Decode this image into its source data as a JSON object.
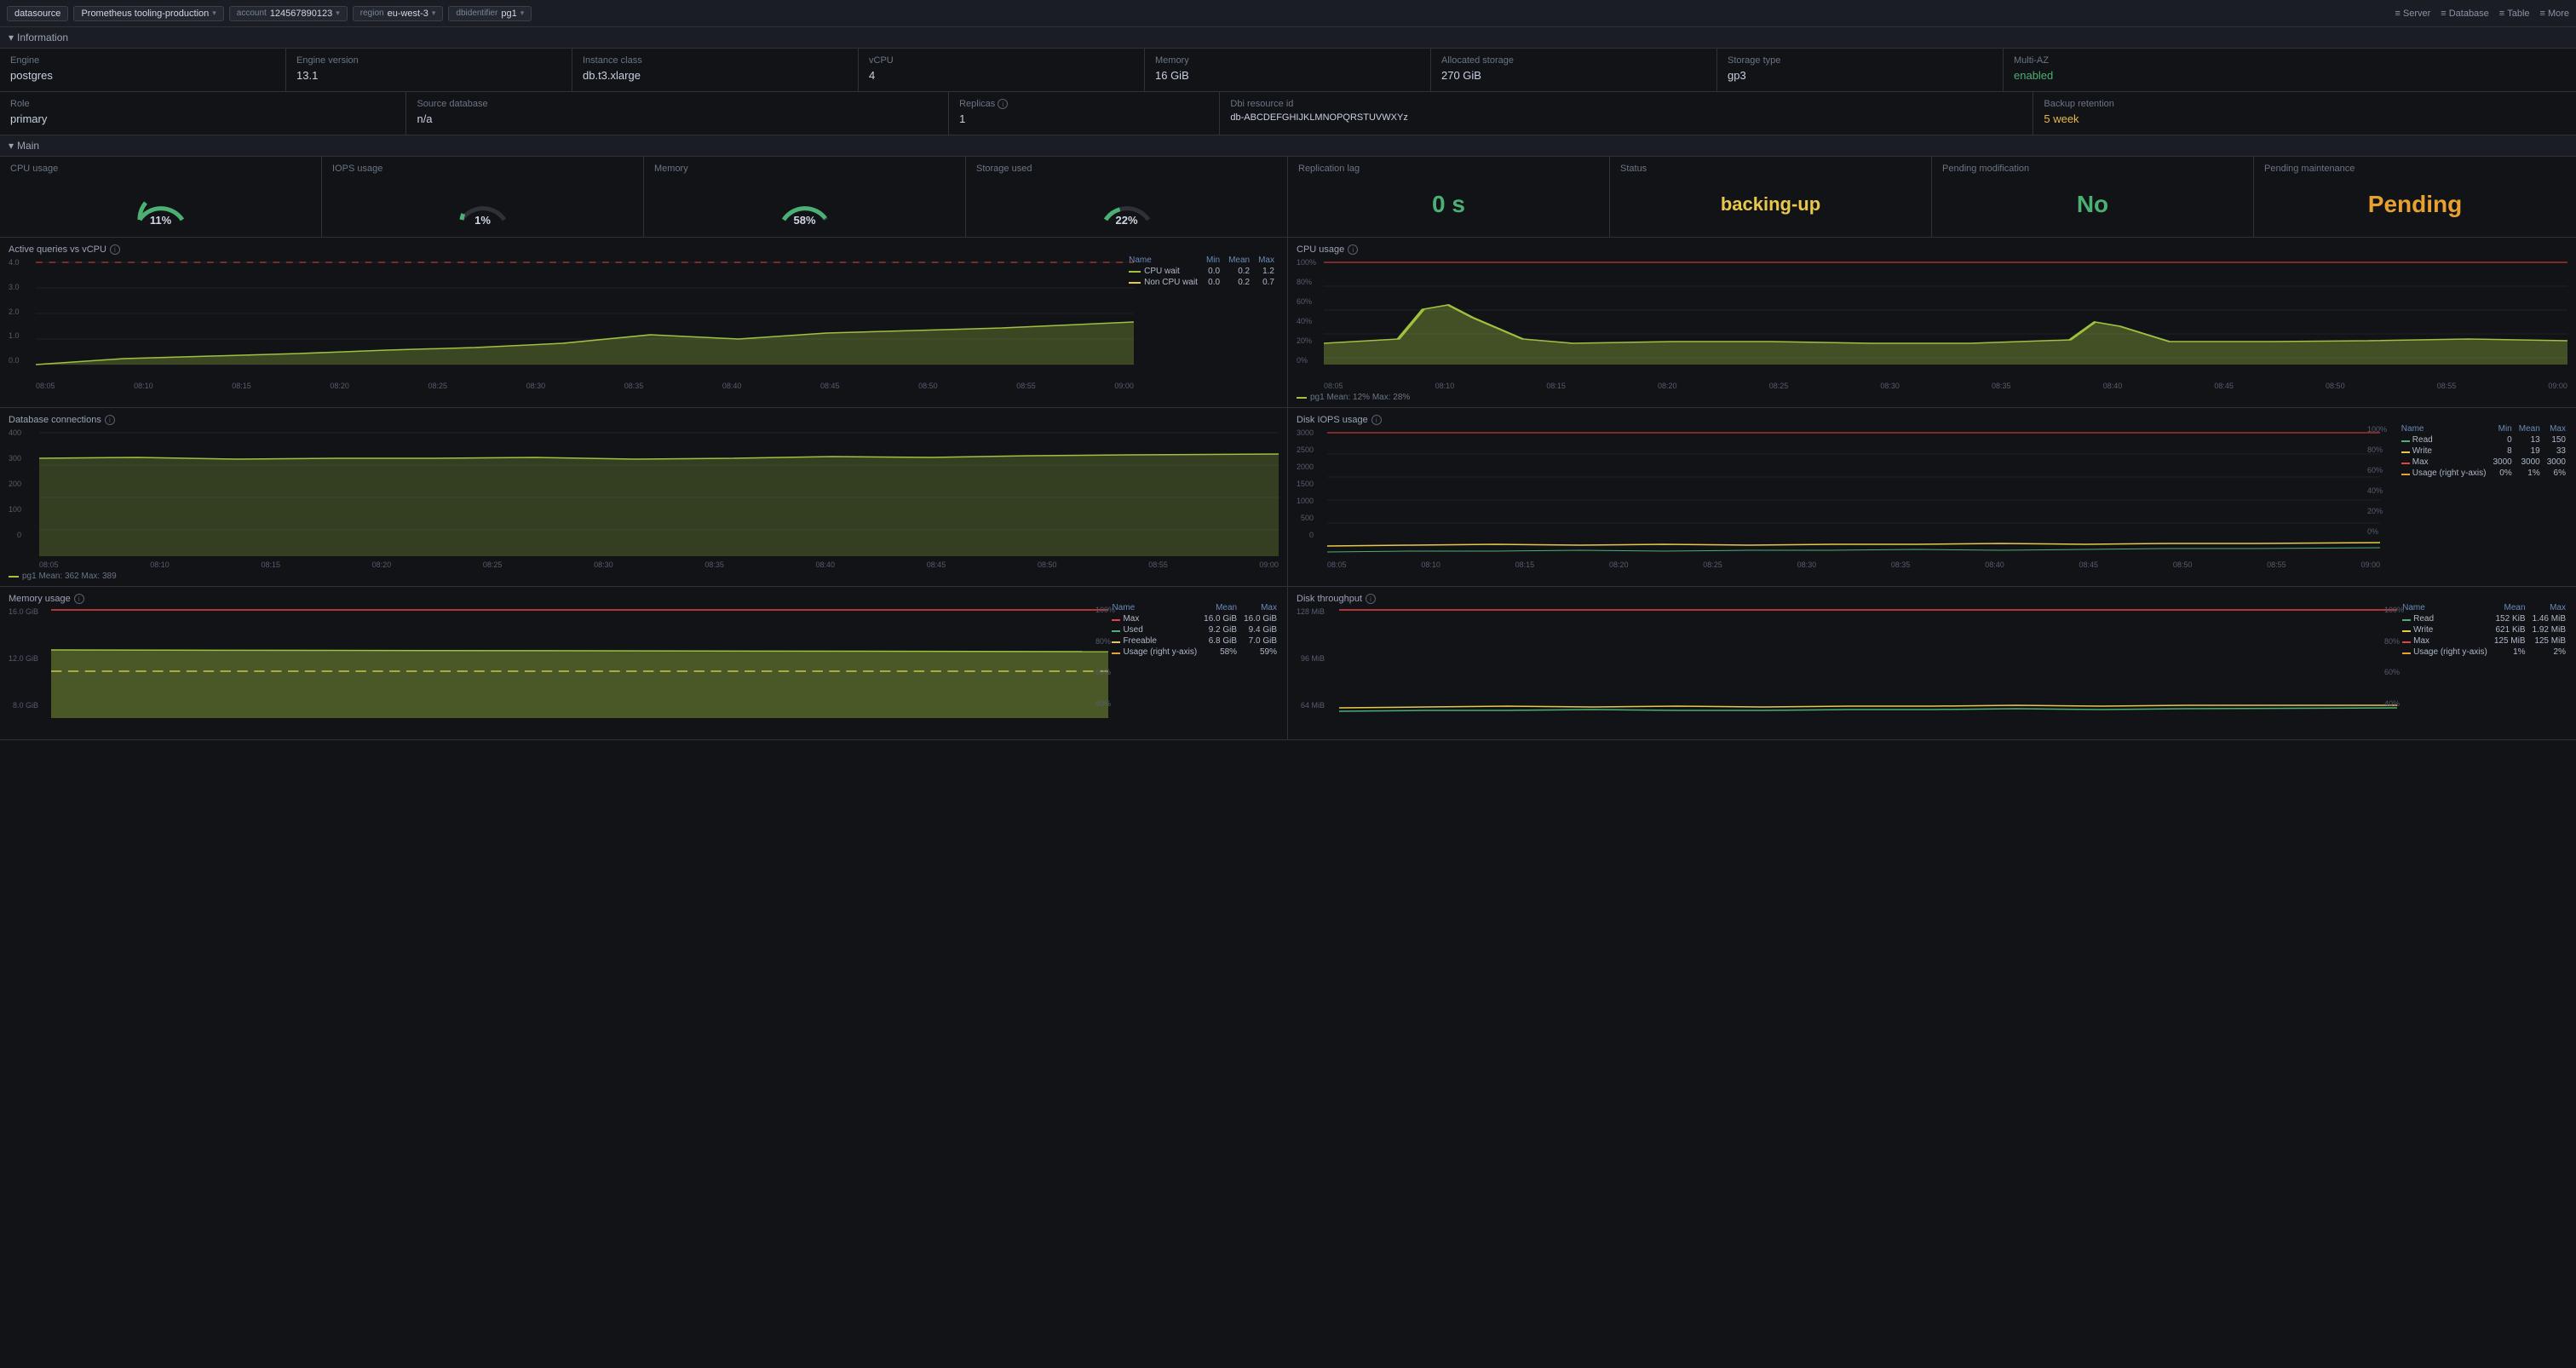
{
  "topbar": {
    "datasource_label": "datasource",
    "datasource_value": "Prometheus tooling-production",
    "account_label": "account",
    "account_value": "124567890123",
    "region_label": "region",
    "region_value": "eu-west-3",
    "dbidentifier_label": "dbidentifier",
    "dbidentifier_value": "pg1",
    "nav_items": [
      "Server",
      "Database",
      "Table",
      "More"
    ]
  },
  "information": {
    "section_label": "Information",
    "cells": [
      {
        "label": "Engine",
        "value": "postgres",
        "color": ""
      },
      {
        "label": "Engine version",
        "value": "13.1",
        "color": ""
      },
      {
        "label": "Instance class",
        "value": "db.t3.xlarge",
        "color": ""
      },
      {
        "label": "vCPU",
        "value": "4",
        "color": ""
      },
      {
        "label": "Memory",
        "value": "16 GiB",
        "color": ""
      },
      {
        "label": "Allocated storage",
        "value": "270 GiB",
        "color": ""
      },
      {
        "label": "Storage type",
        "value": "gp3",
        "color": ""
      },
      {
        "label": "Multi-AZ",
        "value": "enabled",
        "color": "green"
      }
    ],
    "row2": [
      {
        "label": "Role",
        "value": "primary",
        "color": ""
      },
      {
        "label": "Source database",
        "value": "n/a",
        "color": ""
      },
      {
        "label": "Replicas",
        "value": "1",
        "color": "",
        "info": true
      },
      {
        "label": "Dbi resource id",
        "value": "db-ABCDEFGHIJKLMNOPQRSTUVWXYz",
        "color": ""
      },
      {
        "label": "Backup retention",
        "value": "5 week",
        "color": "yellow"
      }
    ]
  },
  "main": {
    "section_label": "Main",
    "metrics": [
      {
        "label": "CPU usage",
        "value": "11%",
        "type": "gauge",
        "color": "#4caf73"
      },
      {
        "label": "IOPS usage",
        "value": "1%",
        "type": "gauge",
        "color": "#4caf73"
      },
      {
        "label": "Memory",
        "value": "58%",
        "type": "gauge",
        "color": "#4caf73"
      },
      {
        "label": "Storage used",
        "value": "22%",
        "type": "gauge",
        "color": "#4caf73"
      },
      {
        "label": "Replication lag",
        "value": "0 s",
        "type": "big",
        "color": "green"
      },
      {
        "label": "Status",
        "value": "backing-up",
        "type": "big",
        "color": "yellow"
      },
      {
        "label": "Pending modification",
        "value": "No",
        "type": "big",
        "color": "green"
      },
      {
        "label": "Pending maintenance",
        "value": "Pending",
        "type": "big",
        "color": "orange"
      }
    ]
  },
  "charts": {
    "active_queries": {
      "title": "Active queries vs vCPU",
      "legend": [
        {
          "name": "CPU wait",
          "color": "#a0c040",
          "min": "0.0",
          "mean": "0.2",
          "max": "1.2"
        },
        {
          "name": "Non CPU wait",
          "color": "#e8c84b",
          "min": "0.0",
          "mean": "0.2",
          "max": "0.7"
        }
      ],
      "yaxis": [
        "4.0",
        "3.0",
        "2.0",
        "1.0",
        "0.0"
      ],
      "xaxis": [
        "08:05",
        "08:10",
        "08:15",
        "08:20",
        "08:25",
        "08:30",
        "08:35",
        "08:40",
        "08:45",
        "08:50",
        "08:55",
        "09:00"
      ]
    },
    "cpu_usage": {
      "title": "CPU usage",
      "legend_label": "pg1  Mean: 12%  Max: 28%",
      "yaxis": [
        "100%",
        "80%",
        "60%",
        "40%",
        "20%",
        "0%"
      ],
      "xaxis": [
        "08:05",
        "08:10",
        "08:15",
        "08:20",
        "08:25",
        "08:30",
        "08:35",
        "08:40",
        "08:45",
        "08:50",
        "08:55",
        "09:00"
      ]
    },
    "db_connections": {
      "title": "Database connections",
      "legend_label": "pg1  Mean: 362  Max: 389",
      "yaxis": [
        "400",
        "300",
        "200",
        "100",
        "0"
      ],
      "xaxis": [
        "08:05",
        "08:10",
        "08:15",
        "08:20",
        "08:25",
        "08:30",
        "08:35",
        "08:40",
        "08:45",
        "08:50",
        "08:55",
        "09:00"
      ]
    },
    "disk_iops": {
      "title": "Disk IOPS usage",
      "legend": [
        {
          "name": "Read",
          "color": "#4caf73",
          "min": "0",
          "mean": "13",
          "max": "150"
        },
        {
          "name": "Write",
          "color": "#e8c84b",
          "min": "8",
          "mean": "19",
          "max": "33"
        },
        {
          "name": "Max",
          "color": "#e84040",
          "min": "3000",
          "mean": "3000",
          "max": "3000"
        },
        {
          "name": "Usage (right y-axis)",
          "color": "#e8a030",
          "min": "0%",
          "mean": "1%",
          "max": "6%"
        }
      ],
      "yaxis": [
        "3000",
        "2500",
        "2000",
        "1500",
        "1000",
        "500",
        "0"
      ],
      "yaxis_right": [
        "100%",
        "80%",
        "60%",
        "40%",
        "20%",
        "0%"
      ],
      "xaxis": [
        "08:05",
        "08:10",
        "08:15",
        "08:20",
        "08:25",
        "08:30",
        "08:35",
        "08:40",
        "08:45",
        "08:50",
        "08:55",
        "09:00"
      ]
    },
    "memory_usage": {
      "title": "Memory usage",
      "legend": [
        {
          "name": "Max",
          "color": "#e84040",
          "mean": "16.0 GiB",
          "max": "16.0 GiB"
        },
        {
          "name": "Used",
          "color": "#4caf73",
          "mean": "9.2 GiB",
          "max": "9.4 GiB"
        },
        {
          "name": "Freeable",
          "color": "#e8c84b",
          "mean": "6.8 GiB",
          "max": "7.0 GiB"
        },
        {
          "name": "Usage (right y-axis)",
          "color": "#e8a030",
          "mean": "58%",
          "max": "59%"
        }
      ],
      "yaxis": [
        "16.0 GiB",
        "12.0 GiB",
        "8.0 GiB"
      ],
      "yaxis_right": [
        "100%",
        "80%",
        "60%",
        "40%"
      ],
      "xaxis": []
    },
    "disk_throughput": {
      "title": "Disk throughput",
      "legend": [
        {
          "name": "Read",
          "color": "#4caf73",
          "mean": "152 KiB",
          "max": "1.46 MiB"
        },
        {
          "name": "Write",
          "color": "#e8c84b",
          "mean": "621 KiB",
          "max": "1.92 MiB"
        },
        {
          "name": "Max",
          "color": "#e84040",
          "mean": "125 MiB",
          "max": "125 MiB"
        },
        {
          "name": "Usage (right y-axis)",
          "color": "#e8a030",
          "mean": "1%",
          "max": "2%"
        }
      ],
      "yaxis": [
        "128 MiB",
        "96 MiB",
        "64 MiB"
      ],
      "yaxis_right": [
        "100%",
        "80%",
        "60%",
        "40%"
      ],
      "xaxis": []
    }
  },
  "colors": {
    "bg_dark": "#111317",
    "bg_panel": "#1a1d23",
    "border": "#2e3138",
    "green": "#4caf73",
    "yellow": "#e8c84b",
    "orange": "#e8a030",
    "red": "#e84040",
    "blue": "#6b8ab5",
    "text_muted": "#6b7585"
  }
}
